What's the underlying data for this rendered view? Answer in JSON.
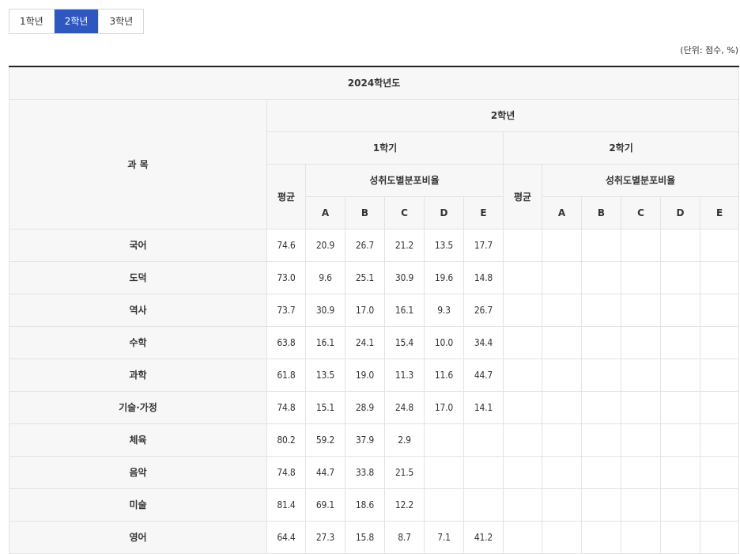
{
  "tabs": [
    {
      "label": "1학년",
      "active": false
    },
    {
      "label": "2학년",
      "active": true
    },
    {
      "label": "3학년",
      "active": false
    }
  ],
  "unit_note": "(단위: 점수, %)",
  "table": {
    "year_header": "2024학년도",
    "subject_header": "과 목",
    "grade_header": "2학년",
    "semester1_header": "1학기",
    "semester2_header": "2학기",
    "avg_header": "평균",
    "dist_header": "성취도별분포비율",
    "grade_cols": [
      "A",
      "B",
      "C",
      "D",
      "E"
    ],
    "rows": [
      {
        "subject": "국어",
        "s1": [
          "74.6",
          "20.9",
          "26.7",
          "21.2",
          "13.5",
          "17.7"
        ],
        "s2": [
          "",
          "",
          "",
          "",
          "",
          ""
        ]
      },
      {
        "subject": "도덕",
        "s1": [
          "73.0",
          "9.6",
          "25.1",
          "30.9",
          "19.6",
          "14.8"
        ],
        "s2": [
          "",
          "",
          "",
          "",
          "",
          ""
        ]
      },
      {
        "subject": "역사",
        "s1": [
          "73.7",
          "30.9",
          "17.0",
          "16.1",
          "9.3",
          "26.7"
        ],
        "s2": [
          "",
          "",
          "",
          "",
          "",
          ""
        ]
      },
      {
        "subject": "수학",
        "s1": [
          "63.8",
          "16.1",
          "24.1",
          "15.4",
          "10.0",
          "34.4"
        ],
        "s2": [
          "",
          "",
          "",
          "",
          "",
          ""
        ]
      },
      {
        "subject": "과학",
        "s1": [
          "61.8",
          "13.5",
          "19.0",
          "11.3",
          "11.6",
          "44.7"
        ],
        "s2": [
          "",
          "",
          "",
          "",
          "",
          ""
        ]
      },
      {
        "subject": "기술·가정",
        "s1": [
          "74.8",
          "15.1",
          "28.9",
          "24.8",
          "17.0",
          "14.1"
        ],
        "s2": [
          "",
          "",
          "",
          "",
          "",
          ""
        ]
      },
      {
        "subject": "체육",
        "s1": [
          "80.2",
          "59.2",
          "37.9",
          "2.9",
          "",
          ""
        ],
        "s2": [
          "",
          "",
          "",
          "",
          "",
          ""
        ]
      },
      {
        "subject": "음악",
        "s1": [
          "74.8",
          "44.7",
          "33.8",
          "21.5",
          "",
          ""
        ],
        "s2": [
          "",
          "",
          "",
          "",
          "",
          ""
        ]
      },
      {
        "subject": "미술",
        "s1": [
          "81.4",
          "69.1",
          "18.6",
          "12.2",
          "",
          ""
        ],
        "s2": [
          "",
          "",
          "",
          "",
          "",
          ""
        ]
      },
      {
        "subject": "영어",
        "s1": [
          "64.4",
          "27.3",
          "15.8",
          "8.7",
          "7.1",
          "41.2"
        ],
        "s2": [
          "",
          "",
          "",
          "",
          "",
          ""
        ]
      }
    ]
  }
}
